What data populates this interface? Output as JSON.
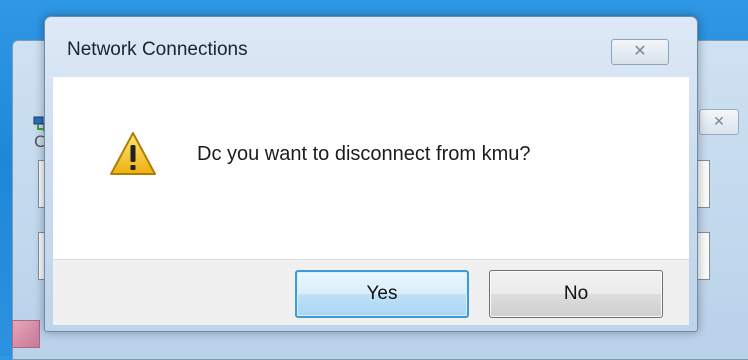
{
  "dialog": {
    "title": "Network Connections",
    "close_glyph": "✕",
    "message": "Dc you want to disconnect from kmu?",
    "icon": "warning-icon",
    "buttons": {
      "yes_label": "Yes",
      "no_label": "No"
    }
  },
  "background_window": {
    "close_glyph": "✕",
    "partial_letter": "C",
    "icon": "network-icon"
  },
  "colors": {
    "desktop": "#2f98e6",
    "dialog_frame": "#c9dbef",
    "default_button_border": "#3c9ad8",
    "warning_yellow": "#f2c31b"
  }
}
